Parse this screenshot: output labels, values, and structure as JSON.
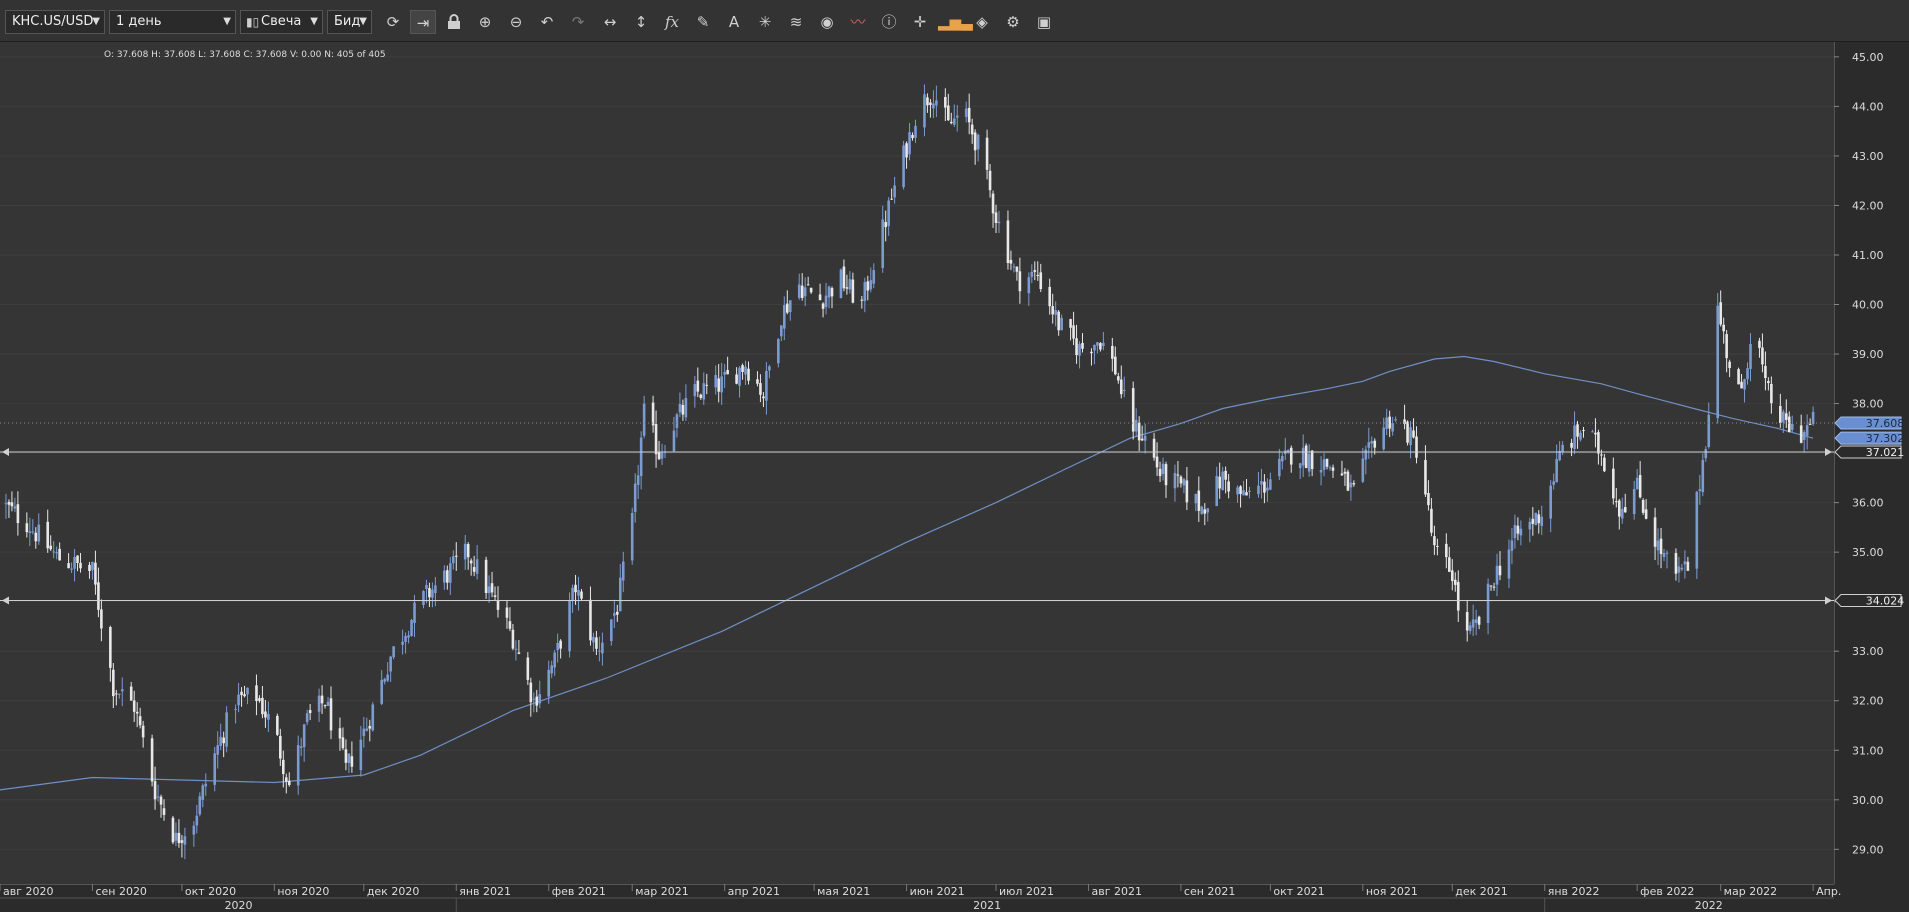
{
  "toolbar": {
    "symbol": "KHC.US/USD",
    "timeframe": "1 день",
    "chart_style": "Свеча",
    "price_side": "Бид",
    "icons": [
      "refresh-icon",
      "shift-right-icon",
      "lock-icon",
      "zoom-in-icon",
      "zoom-out-icon",
      "undo-icon",
      "redo-icon",
      "horizontal-scale-icon",
      "vertical-scale-icon",
      "indicators-fx-icon",
      "pencil-icon",
      "text-icon",
      "crosshair-icon",
      "layers-icon",
      "eye-icon",
      "signals-icon",
      "info-icon",
      "cursor-icon",
      "volume-icon",
      "paint-icon",
      "settings-icon",
      "save-icon"
    ]
  },
  "ohlc_info": "O: 37.608  H: 37.608  L: 37.608  C: 37.608  V: 0.00  N: 405 of 405",
  "colors": {
    "up": "#7b9bd1",
    "down": "#e8e8e8",
    "ma": "#6f8fc4",
    "level": "#d0d0d0",
    "last_price_tag": "#6a8fd0",
    "background": "#353535"
  },
  "price_tags": [
    {
      "label": "37.608",
      "price": 37.608,
      "style": "blue"
    },
    {
      "label": "37.302",
      "price": 37.302,
      "style": "blue"
    },
    {
      "label": "37.021",
      "price": 37.021,
      "style": "line"
    },
    {
      "label": "34.024",
      "price": 34.024,
      "style": "line"
    }
  ],
  "chart_data": {
    "type": "candlestick",
    "ylim": [
      28.3,
      45.3
    ],
    "y_ticks": [
      "29.00",
      "30.00",
      "31.00",
      "32.00",
      "33.00",
      "34.00",
      "35.00",
      "36.00",
      "37.00",
      "38.00",
      "39.00",
      "40.00",
      "41.00",
      "42.00",
      "43.00",
      "44.00",
      "45.00"
    ],
    "x_start": "2020-08-01",
    "x_end": "2022-04-08",
    "month_labels": [
      {
        "label": "авг 2020",
        "date": "2020-08-01"
      },
      {
        "label": "сен 2020",
        "date": "2020-09-01"
      },
      {
        "label": "окт 2020",
        "date": "2020-10-01"
      },
      {
        "label": "ноя 2020",
        "date": "2020-11-01"
      },
      {
        "label": "дек 2020",
        "date": "2020-12-01"
      },
      {
        "label": "янв 2021",
        "date": "2021-01-01"
      },
      {
        "label": "фев 2021",
        "date": "2021-02-01"
      },
      {
        "label": "мар 2021",
        "date": "2021-03-01"
      },
      {
        "label": "апр 2021",
        "date": "2021-04-01"
      },
      {
        "label": "мая 2021",
        "date": "2021-05-01"
      },
      {
        "label": "июн 2021",
        "date": "2021-06-01"
      },
      {
        "label": "июл 2021",
        "date": "2021-07-01"
      },
      {
        "label": "авг 2021",
        "date": "2021-08-01"
      },
      {
        "label": "сен 2021",
        "date": "2021-09-01"
      },
      {
        "label": "окт 2021",
        "date": "2021-10-01"
      },
      {
        "label": "ноя 2021",
        "date": "2021-11-01"
      },
      {
        "label": "дек 2021",
        "date": "2021-12-01"
      },
      {
        "label": "янв 2022",
        "date": "2022-01-01"
      },
      {
        "label": "фев 2022",
        "date": "2022-02-01"
      },
      {
        "label": "мар 2022",
        "date": "2022-03-01"
      },
      {
        "label": "Апр.",
        "date": "2022-04-01"
      }
    ],
    "year_labels": [
      {
        "label": "2020",
        "date": "2020-10-20"
      },
      {
        "label": "2021",
        "date": "2021-06-28"
      },
      {
        "label": "2022",
        "date": "2022-02-25"
      }
    ],
    "horizontal_levels": [
      37.021,
      34.024
    ],
    "price_path": [
      [
        "2020-08-01",
        36.0
      ],
      [
        "2020-08-10",
        35.6
      ],
      [
        "2020-08-20",
        34.9
      ],
      [
        "2020-09-01",
        34.6
      ],
      [
        "2020-09-08",
        32.3
      ],
      [
        "2020-09-15",
        31.9
      ],
      [
        "2020-09-22",
        30.2
      ],
      [
        "2020-09-29",
        29.2
      ],
      [
        "2020-10-05",
        29.6
      ],
      [
        "2020-10-12",
        30.9
      ],
      [
        "2020-10-19",
        32.0
      ],
      [
        "2020-10-26",
        32.1
      ],
      [
        "2020-11-01",
        31.4
      ],
      [
        "2020-11-06",
        30.3
      ],
      [
        "2020-11-12",
        31.6
      ],
      [
        "2020-11-18",
        32.0
      ],
      [
        "2020-11-25",
        30.6
      ],
      [
        "2020-12-02",
        31.5
      ],
      [
        "2020-12-10",
        32.9
      ],
      [
        "2020-12-20",
        34.0
      ],
      [
        "2020-12-28",
        34.5
      ],
      [
        "2021-01-05",
        35.0
      ],
      [
        "2021-01-12",
        34.2
      ],
      [
        "2021-01-20",
        33.3
      ],
      [
        "2021-01-27",
        32.0
      ],
      [
        "2021-02-03",
        32.8
      ],
      [
        "2021-02-10",
        34.3
      ],
      [
        "2021-02-17",
        33.0
      ],
      [
        "2021-02-24",
        33.9
      ],
      [
        "2021-03-01",
        35.6
      ],
      [
        "2021-03-05",
        37.8
      ],
      [
        "2021-03-10",
        37.0
      ],
      [
        "2021-03-15",
        37.6
      ],
      [
        "2021-03-22",
        38.2
      ],
      [
        "2021-03-31",
        38.4
      ],
      [
        "2021-04-08",
        38.8
      ],
      [
        "2021-04-14",
        38.2
      ],
      [
        "2021-04-20",
        39.8
      ],
      [
        "2021-04-26",
        40.4
      ],
      [
        "2021-05-03",
        40.1
      ],
      [
        "2021-05-10",
        40.5
      ],
      [
        "2021-05-17",
        40.0
      ],
      [
        "2021-05-24",
        41.5
      ],
      [
        "2021-05-31",
        43.0
      ],
      [
        "2021-06-05",
        44.0
      ],
      [
        "2021-06-10",
        44.3
      ],
      [
        "2021-06-15",
        43.6
      ],
      [
        "2021-06-20",
        43.9
      ],
      [
        "2021-06-25",
        43.2
      ],
      [
        "2021-07-01",
        41.8
      ],
      [
        "2021-07-08",
        40.5
      ],
      [
        "2021-07-15",
        40.6
      ],
      [
        "2021-07-22",
        39.6
      ],
      [
        "2021-07-29",
        39.1
      ],
      [
        "2021-08-05",
        39.3
      ],
      [
        "2021-08-10",
        38.7
      ],
      [
        "2021-08-15",
        37.6
      ],
      [
        "2021-08-20",
        37.3
      ],
      [
        "2021-08-25",
        36.6
      ],
      [
        "2021-09-01",
        36.3
      ],
      [
        "2021-09-08",
        35.9
      ],
      [
        "2021-09-15",
        36.5
      ],
      [
        "2021-09-22",
        36.1
      ],
      [
        "2021-09-30",
        36.4
      ],
      [
        "2021-10-08",
        37.0
      ],
      [
        "2021-10-15",
        36.9
      ],
      [
        "2021-10-22",
        36.7
      ],
      [
        "2021-10-29",
        36.2
      ],
      [
        "2021-11-05",
        37.3
      ],
      [
        "2021-11-10",
        37.7
      ],
      [
        "2021-11-15",
        37.5
      ],
      [
        "2021-11-20",
        37.0
      ],
      [
        "2021-11-25",
        35.0
      ],
      [
        "2021-12-01",
        34.6
      ],
      [
        "2021-12-05",
        33.2
      ],
      [
        "2021-12-10",
        33.6
      ],
      [
        "2021-12-15",
        34.5
      ],
      [
        "2021-12-22",
        35.3
      ],
      [
        "2021-12-31",
        35.8
      ],
      [
        "2022-01-07",
        37.1
      ],
      [
        "2022-01-14",
        37.5
      ],
      [
        "2022-01-20",
        37.0
      ],
      [
        "2022-01-26",
        35.9
      ],
      [
        "2022-02-01",
        36.3
      ],
      [
        "2022-02-08",
        35.1
      ],
      [
        "2022-02-14",
        34.5
      ],
      [
        "2022-02-18",
        34.7
      ],
      [
        "2022-02-24",
        37.3
      ],
      [
        "2022-02-28",
        39.9
      ],
      [
        "2022-03-04",
        38.8
      ],
      [
        "2022-03-08",
        38.1
      ],
      [
        "2022-03-12",
        39.8
      ],
      [
        "2022-03-16",
        38.3
      ],
      [
        "2022-03-22",
        37.6
      ],
      [
        "2022-03-28",
        37.4
      ],
      [
        "2022-04-01",
        37.608
      ]
    ],
    "ma_path": [
      [
        "2020-08-01",
        30.2
      ],
      [
        "2020-09-01",
        30.45
      ],
      [
        "2020-10-01",
        30.4
      ],
      [
        "2020-11-01",
        30.35
      ],
      [
        "2020-12-01",
        30.5
      ],
      [
        "2020-12-20",
        30.9
      ],
      [
        "2021-01-20",
        31.8
      ],
      [
        "2021-02-20",
        32.45
      ],
      [
        "2021-03-31",
        33.4
      ],
      [
        "2021-05-01",
        34.3
      ],
      [
        "2021-06-01",
        35.2
      ],
      [
        "2021-07-01",
        36.0
      ],
      [
        "2021-07-25",
        36.7
      ],
      [
        "2021-08-15",
        37.3
      ],
      [
        "2021-09-01",
        37.6
      ],
      [
        "2021-09-15",
        37.9
      ],
      [
        "2021-10-01",
        38.1
      ],
      [
        "2021-10-20",
        38.3
      ],
      [
        "2021-11-01",
        38.45
      ],
      [
        "2021-11-10",
        38.65
      ],
      [
        "2021-11-25",
        38.9
      ],
      [
        "2021-12-05",
        38.95
      ],
      [
        "2021-12-15",
        38.85
      ],
      [
        "2022-01-01",
        38.6
      ],
      [
        "2022-01-20",
        38.4
      ],
      [
        "2022-02-01",
        38.2
      ],
      [
        "2022-02-20",
        37.9
      ],
      [
        "2022-03-05",
        37.7
      ],
      [
        "2022-03-20",
        37.5
      ],
      [
        "2022-04-01",
        37.3
      ]
    ]
  }
}
